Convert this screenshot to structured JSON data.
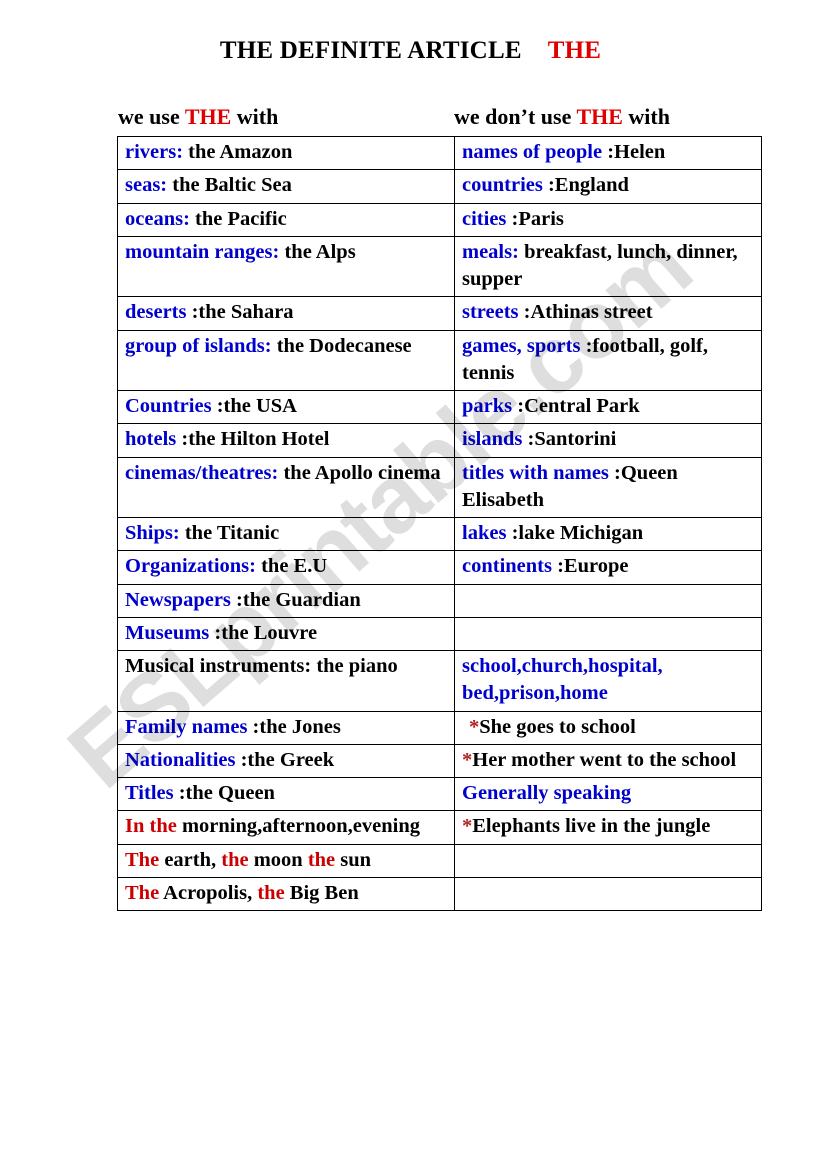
{
  "title": {
    "main": "THE DEFINITE ARTICLE",
    "accent": "THE"
  },
  "headings": {
    "left_pre": "we use ",
    "left_accent": "THE",
    "left_post": " with",
    "right_pre": "we don’t use ",
    "right_accent": "THE",
    "right_post": " with"
  },
  "colors": {
    "accent_red": "#e00000",
    "label_blue": "#0000cc",
    "label_red": "#cc0000",
    "text_black": "#000000",
    "star_red": "#b02020",
    "border": "#000000",
    "background": "#ffffff"
  },
  "watermark": {
    "text": "ESLprintable.com"
  },
  "rows": [
    {
      "left": {
        "label": "rivers:",
        "label_color": "blue",
        "value": " the Amazon",
        "value_color": "black"
      },
      "right": {
        "label": "names of people",
        "label_color": "blue",
        "value": " :Helen",
        "value_color": "black"
      }
    },
    {
      "left": {
        "label": "seas:",
        "label_color": "blue",
        "value": " the Baltic Sea",
        "value_color": "black"
      },
      "right": {
        "label": "countries",
        "label_color": "blue",
        "value": " :England",
        "value_color": "black"
      }
    },
    {
      "left": {
        "label": "oceans:",
        "label_color": "blue",
        "value": " the Pacific",
        "value_color": "black"
      },
      "right": {
        "label": "cities",
        "label_color": "blue",
        "value": " :Paris",
        "value_color": "black"
      }
    },
    {
      "left": {
        "label": "mountain ranges:",
        "label_color": "blue",
        "value": " the Alps",
        "value_color": "black"
      },
      "right": {
        "label": "meals:",
        "label_color": "blue",
        "value": " breakfast, lunch, dinner, supper",
        "value_color": "black"
      }
    },
    {
      "left": {
        "label": "deserts",
        "label_color": "blue",
        "value": " :the Sahara",
        "value_color": "black"
      },
      "right": {
        "label": "streets",
        "label_color": "blue",
        "value": " :Athinas street",
        "value_color": "black"
      }
    },
    {
      "left": {
        "label": "group of islands:",
        "label_color": "blue",
        "value": " the Dodecanese",
        "value_color": "black"
      },
      "right": {
        "label": "games, sports",
        "label_color": "blue",
        "value": " :football, golf, tennis",
        "value_color": "black"
      }
    },
    {
      "left": {
        "label": "Countries",
        "label_color": "blue",
        "value": " :the USA",
        "value_color": "black"
      },
      "right": {
        "label": "parks",
        "label_color": "blue",
        "value": " :Central Park",
        "value_color": "black"
      }
    },
    {
      "left": {
        "label": "hotels",
        "label_color": "blue",
        "value": " :the Hilton Hotel",
        "value_color": "black"
      },
      "right": {
        "label": "islands",
        "label_color": "blue",
        "value": " :Santorini",
        "value_color": "black"
      }
    },
    {
      "left": {
        "label": "cinemas/theatres:",
        "label_color": "blue",
        "value": " the Apollo cinema",
        "value_color": "black"
      },
      "right": {
        "label": "titles with names",
        "label_color": "blue",
        "value": " :Queen Elisabeth",
        "value_color": "black"
      }
    },
    {
      "left": {
        "label": "Ships:",
        "label_color": "blue",
        "value": " the Titanic",
        "value_color": "black"
      },
      "right": {
        "label": "lakes",
        "label_color": "blue",
        "value": " :lake Michigan",
        "value_color": "black"
      }
    },
    {
      "left": {
        "label": "Organizations:",
        "label_color": "blue",
        "value": " the E.U",
        "value_color": "black"
      },
      "right": {
        "label": "continents",
        "label_color": "blue",
        "value": " :Europe",
        "value_color": "black"
      }
    },
    {
      "left": {
        "label": "Newspapers",
        "label_color": "blue",
        "value": " :the Guardian",
        "value_color": "black"
      },
      "right": {
        "label": "",
        "label_color": "blue",
        "value": "",
        "value_color": "black"
      }
    },
    {
      "left": {
        "label": "Museums",
        "label_color": "blue",
        "value": " :the Louvre",
        "value_color": "black"
      },
      "right": {
        "label": "",
        "label_color": "blue",
        "value": "",
        "value_color": "black"
      }
    },
    {
      "left": {
        "label": "Musical instruments:",
        "label_color": "black",
        "value": " the piano",
        "value_color": "black"
      },
      "right": {
        "label": "school,church,hospital, bed,prison,home",
        "label_color": "blue",
        "value": "",
        "value_color": "blue"
      }
    },
    {
      "left": {
        "label": "Family names",
        "label_color": "blue",
        "value": " :the Jones",
        "value_color": "black"
      },
      "right": {
        "label": "*",
        "label_color": "star",
        "value": "She goes to school",
        "value_color": "black",
        "indent": true
      }
    },
    {
      "left": {
        "label": "Nationalities",
        "label_color": "blue",
        "value": " :the Greek",
        "value_color": "black"
      },
      "right": {
        "label": "*",
        "label_color": "star",
        "value": "Her mother went to the school",
        "value_color": "black"
      }
    },
    {
      "left": {
        "label": "Titles",
        "label_color": "blue",
        "value": " :the Queen",
        "value_color": "black"
      },
      "right": {
        "label": "Generally speaking",
        "label_color": "blue",
        "value": "",
        "value_color": "black"
      }
    },
    {
      "left": {
        "label": "In the",
        "label_color": "red",
        "value": " morning,afternoon,evening",
        "value_color": "black"
      },
      "right": {
        "label": "*",
        "label_color": "star",
        "value": "Elephants live in the jungle",
        "value_color": "black"
      }
    },
    {
      "left": {
        "label": "The",
        "label_color": "red",
        "value": " earth, ",
        "value_color": "black",
        "label2": "the",
        "value2": " moon ",
        "label3": "the",
        "value3": " sun"
      },
      "right": {
        "label": "",
        "label_color": "blue",
        "value": "",
        "value_color": "black"
      }
    },
    {
      "left": {
        "label": "The",
        "label_color": "red",
        "value": " Acropolis, ",
        "value_color": "black",
        "label2": "the",
        "value2": " Big Ben"
      },
      "right": {
        "label": "",
        "label_color": "blue",
        "value": "",
        "value_color": "black"
      }
    }
  ]
}
